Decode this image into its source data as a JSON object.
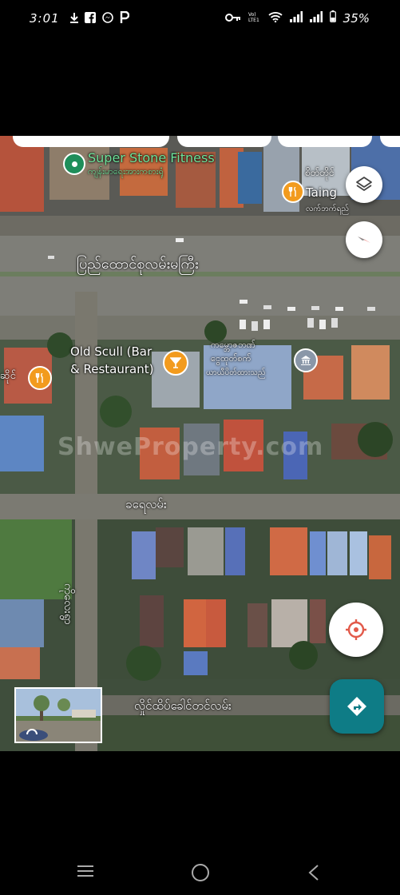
{
  "status_bar": {
    "time": "3:01",
    "battery": "35%",
    "left_icons": [
      "download-icon",
      "facebook-icon",
      "messenger-icon",
      "p-app-icon"
    ],
    "right_icons": [
      "key-icon",
      "volte-icon",
      "wifi-icon",
      "signal-icon",
      "signal-icon",
      "battery-icon"
    ]
  },
  "map": {
    "poi_fitness": "Super Stone Fitness",
    "poi_fitness_sub": "ကျန်းမာရေးအားကစားရုံ",
    "poi_taing_top": "စိတ်တိုင်",
    "poi_taing": "Taing",
    "poi_taing_sub": "လက်ဘက်ရည်",
    "road_main": "ပြည်ထောင်စုလမ်းမကြီး",
    "poi_bar": "Old Scull (Bar & Restaurant)",
    "poi_bar_line1": "Old Scull (Bar",
    "poi_bar_line2": "& Restaurant)",
    "poi_school_line1": "ကမ္ဘောဇဘဏ်",
    "poi_school_line2": "ငွေထုတ်စက်",
    "poi_school_line3": "ယာယီပိတ်ထားသည်",
    "poi_left_food": "ဆိုင်",
    "road_middle": "ခရေလမ်း",
    "road_vertical": "ကိုလေးရွာ",
    "road_bottom": "လှိုင်ထိပ်ခေါင်တင်လမ်း",
    "watermark": "ShweProperty.com"
  },
  "colors": {
    "poi_green": "#1e8e5a",
    "food_orange": "#f29b1e",
    "fab_teal": "#0e7c86",
    "compass_red": "#e53935",
    "target_red": "#e25a4a"
  }
}
